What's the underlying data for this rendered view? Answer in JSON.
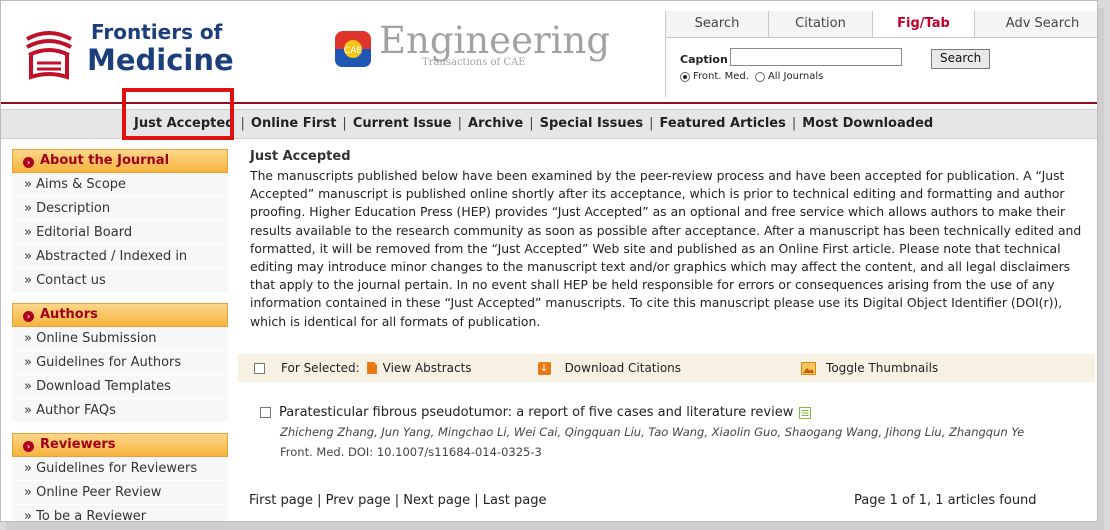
{
  "header": {
    "journal_line1": "Frontiers of",
    "journal_line2": "Medicine",
    "engineering_word": "Engineering",
    "engineering_sub": "Transactions of CAE",
    "engineering_badge": "CAE"
  },
  "search": {
    "tabs": [
      {
        "label": "Search",
        "active": false
      },
      {
        "label": "Citation",
        "active": false
      },
      {
        "label": "Fig/Tab",
        "active": true
      },
      {
        "label": "Adv Search",
        "active": false
      }
    ],
    "caption_label": "Caption",
    "caption_value": "",
    "button_label": "Search",
    "scope_options": [
      {
        "label": "Front. Med.",
        "selected": true
      },
      {
        "label": "All Journals",
        "selected": false
      }
    ]
  },
  "nav": {
    "items": [
      "Just Accepted",
      "Online First",
      "Current Issue",
      "Archive",
      "Special Issues",
      "Featured Articles",
      "Most Downloaded"
    ],
    "highlighted": "Just Accepted"
  },
  "sidebar": {
    "sections": [
      {
        "title": "About the Journal",
        "items": [
          "» Aims & Scope",
          "» Description",
          "» Editorial Board",
          "» Abstracted / Indexed in",
          "» Contact us"
        ]
      },
      {
        "title": "Authors",
        "items": [
          "» Online Submission",
          "» Guidelines for Authors",
          "» Download Templates",
          "» Author FAQs"
        ]
      },
      {
        "title": "Reviewers",
        "items": [
          "» Guidelines for Reviewers",
          "» Online Peer Review",
          "» To be a Reviewer"
        ]
      }
    ]
  },
  "main": {
    "section_title": "Just Accepted",
    "intro": "The manuscripts published below have been examined by the peer-review process and have been accepted for publication. A “Just Accepted” manuscript is published online shortly after its acceptance, which is prior to technical editing and formatting and author proofing. Higher Education Press (HEP) provides “Just Accepted” as an optional and free service which allows authors to make their results available to the research community as soon as possible after acceptance. After a manuscript has been technically edited and formatted, it will be removed from the “Just Accepted” Web site and published as an Online First article. Please note that technical editing may introduce minor changes to the manuscript text and/or graphics which may affect the content, and all legal disclaimers that apply to the journal pertain. In no event shall HEP be held responsible for errors or consequences arising from the use of any information contained in these “Just Accepted” manuscripts. To cite this manuscript please use its Digital Object Identifier (DOI(r)), which is identical for all formats of publication.",
    "actions": {
      "for_selected": "For Selected:",
      "view_abstracts": "View Abstracts",
      "download_citations": "Download Citations",
      "toggle_thumbnails": "Toggle Thumbnails"
    },
    "article": {
      "title": "Paratesticular fibrous pseudotumor: a report of five cases and literature review",
      "authors": "Zhicheng Zhang, Jun Yang, Mingchao Li, Wei Cai, Qingquan Liu, Tao Wang, Xiaolin Guo, Shaogang Wang, Jihong Liu, Zhangqun Ye",
      "meta": "Front. Med.   DOI: 10.1007/s11684-014-0325-3"
    },
    "pager": {
      "first": "First page",
      "prev": "Prev page",
      "next": "Next page",
      "last": "Last page",
      "summary": "Page 1 of 1, 1 articles found"
    }
  },
  "colors": {
    "brand_blue": "#1c3e7d",
    "accent_red": "#c0002a",
    "divider_red": "#8b0f1d",
    "sidebar_head": "#f7b53e",
    "highlight": "#e01010"
  }
}
